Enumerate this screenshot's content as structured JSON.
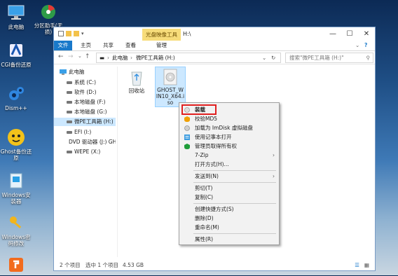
{
  "desktop": {
    "icons": [
      {
        "label": "此电脑",
        "icon": "computer-icon"
      },
      {
        "label": "分区助手(无损)",
        "icon": "partition-icon"
      },
      {
        "label": "CGI备份还原",
        "icon": "cgi-icon"
      },
      {
        "label": "Dism++",
        "icon": "dism-gear-icon"
      },
      {
        "label": "Ghost备份还原",
        "icon": "ghost-icon"
      },
      {
        "label": "Windows安装器",
        "icon": "win-installer-icon"
      },
      {
        "label": "Windows密码修改",
        "icon": "keys-icon"
      },
      {
        "label": "",
        "icon": "orange-app-icon"
      }
    ]
  },
  "window": {
    "context_tab": "光盘映像工具",
    "title": "H:\\",
    "controls": {
      "minimize": "—",
      "maximize": "☐",
      "close": "✕",
      "help": "?",
      "expand": "⌄"
    },
    "ribbon_tabs": [
      "文件",
      "主页",
      "共享",
      "查看",
      "管理"
    ],
    "address": {
      "crumbs": [
        "此电脑",
        "微PE工具箱 (H:)"
      ],
      "refresh": "↻",
      "search_placeholder": "搜索\"微PE工具箱 (H:)\""
    },
    "sidebar": {
      "items": [
        {
          "label": "此电脑",
          "type": "computer"
        },
        {
          "label": "系统 (C:)",
          "type": "drive"
        },
        {
          "label": "软件 (D:)",
          "type": "drive"
        },
        {
          "label": "本地磁盘 (F:)",
          "type": "drive"
        },
        {
          "label": "本地磁盘 (G:)",
          "type": "drive"
        },
        {
          "label": "微PE工具箱 (H:)",
          "type": "drive",
          "selected": true
        },
        {
          "label": "EFI (I:)",
          "type": "drive"
        },
        {
          "label": "DVD 驱动器 (J:) GH",
          "type": "dvd"
        },
        {
          "label": "WEPE (X:)",
          "type": "drive"
        }
      ]
    },
    "files": [
      {
        "name": "回收站",
        "icon": "recycle-bin-icon"
      },
      {
        "name": "GHOST_WIN10_X64.iso",
        "display": [
          "GHOST_W",
          "IN10_X64.i",
          "so"
        ],
        "icon": "disc-image-icon",
        "selected": true
      }
    ],
    "status": {
      "items": "2 个项目",
      "selected": "选中 1 个项目",
      "size": "4.53 GB"
    }
  },
  "context_menu": {
    "items": [
      {
        "label": "装载",
        "bold": true,
        "icon": "mount-disc-icon",
        "highlighted": true
      },
      {
        "label": "校验MD5",
        "icon": "shield-warn-icon"
      },
      {
        "label": "加载为 ImDisk 虚拟磁盘",
        "icon": "imdisk-icon"
      },
      {
        "label": "使用记事本打开",
        "icon": "notepad-icon"
      },
      {
        "label": "管理员取得所有权",
        "icon": "shield-green-icon"
      },
      {
        "label": "7-Zip",
        "submenu": true
      },
      {
        "label": "打开方式(H)..."
      },
      {
        "sep": true
      },
      {
        "label": "发送到(N)",
        "submenu": true
      },
      {
        "sep": true
      },
      {
        "label": "剪切(T)"
      },
      {
        "label": "复制(C)"
      },
      {
        "sep": true
      },
      {
        "label": "创建快捷方式(S)"
      },
      {
        "label": "删除(D)"
      },
      {
        "label": "重命名(M)"
      },
      {
        "sep": true
      },
      {
        "label": "属性(R)"
      }
    ]
  },
  "colors": {
    "accent": "#1979ca",
    "selection": "#cce8ff",
    "context_tab": "#f7dc7a",
    "highlight_box": "#e02020"
  }
}
